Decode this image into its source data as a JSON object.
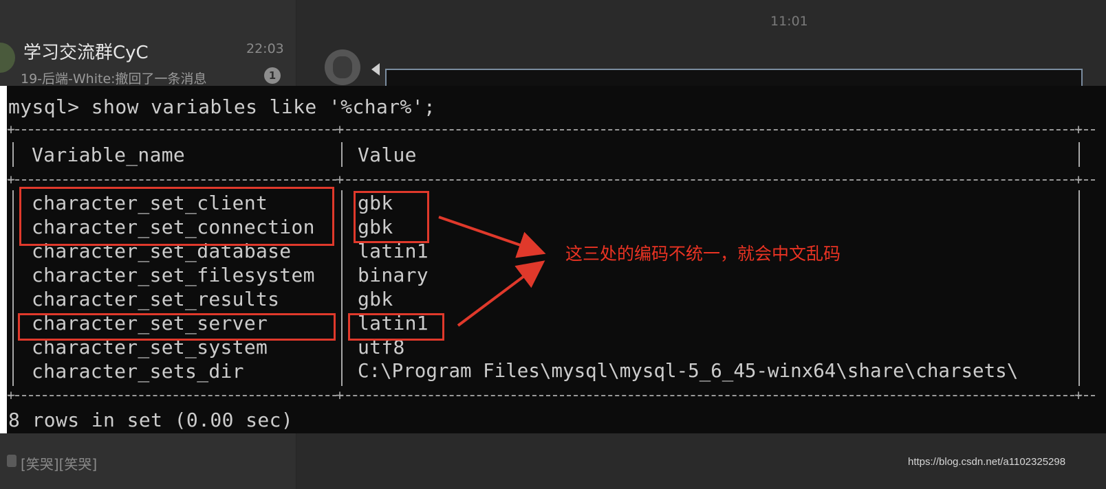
{
  "chat_list": {
    "group_name": "学习交流群CyC",
    "time": "22:03",
    "preview": "19-后端-White:撤回了一条消息",
    "unread_count": "1",
    "bottom_preview": "[笑哭][笑哭]"
  },
  "conversation": {
    "timestamp": "11:01"
  },
  "terminal": {
    "command": "mysql> show variables like '%char%';",
    "headers": [
      "Variable_name",
      "Value"
    ],
    "rows": [
      {
        "name": "character_set_client",
        "value": "gbk"
      },
      {
        "name": "character_set_connection",
        "value": "gbk"
      },
      {
        "name": "character_set_database",
        "value": "latin1"
      },
      {
        "name": "character_set_filesystem",
        "value": "binary"
      },
      {
        "name": "character_set_results",
        "value": "gbk"
      },
      {
        "name": "character_set_server",
        "value": "latin1"
      },
      {
        "name": "character_set_system",
        "value": "utf8"
      },
      {
        "name": "character_sets_dir",
        "value": "C:\\Program Files\\mysql\\mysql-5_6_45-winx64\\share\\charsets\\"
      }
    ],
    "footer": "8 rows in set (0.00 sec)"
  },
  "annotation": {
    "text": "这三处的编码不统一，就会中文乱码",
    "color": "#ea3323"
  },
  "watermark": "https://blog.csdn.net/a1102325298"
}
